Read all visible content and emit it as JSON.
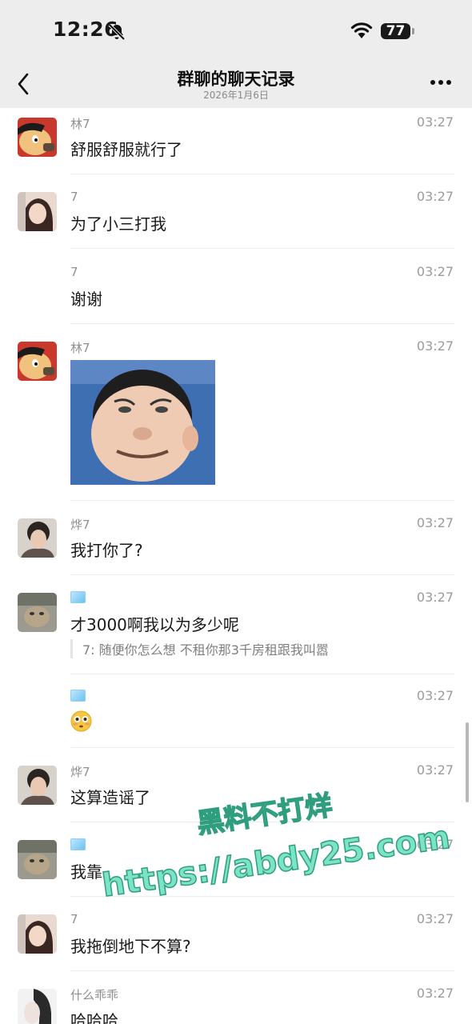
{
  "status_bar": {
    "time": "12:26",
    "battery": "77"
  },
  "nav": {
    "title": "群聊的聊天记录",
    "subtitle": "2026年1月6日"
  },
  "messages": [
    {
      "sender": "林7",
      "time": "03:27",
      "text": "舒服舒服就行了"
    },
    {
      "sender": "7",
      "time": "03:27",
      "text": "为了小三打我"
    },
    {
      "sender": "7",
      "time": "03:27",
      "text": "谢谢"
    },
    {
      "sender": "林7",
      "time": "03:27",
      "text": ""
    },
    {
      "sender": "烨7",
      "time": "03:27",
      "text": "我打你了?"
    },
    {
      "sender": "",
      "time": "03:27",
      "text": "才3000啊我以为多少呢",
      "quote": "7:  随便你怎么想 不租你那3千房租跟我叫嚣"
    },
    {
      "sender": "",
      "time": "03:27",
      "text": "😳"
    },
    {
      "sender": "烨7",
      "time": "03:27",
      "text": "这算造谣了"
    },
    {
      "sender": "",
      "time": "03:27",
      "text": "我靠"
    },
    {
      "sender": "7",
      "time": "03:27",
      "text": "我拖倒地下不算?"
    },
    {
      "sender": "什么乖乖",
      "time": "03:27",
      "text": "哈哈哈"
    }
  ],
  "watermark": {
    "line1": "黑料不打烊",
    "line2": "https://abdy25.com"
  },
  "colors": {
    "watermark_fill": "#7be3c6",
    "watermark_stroke": "#2f9e7f",
    "nav_bg": "#ededed"
  }
}
